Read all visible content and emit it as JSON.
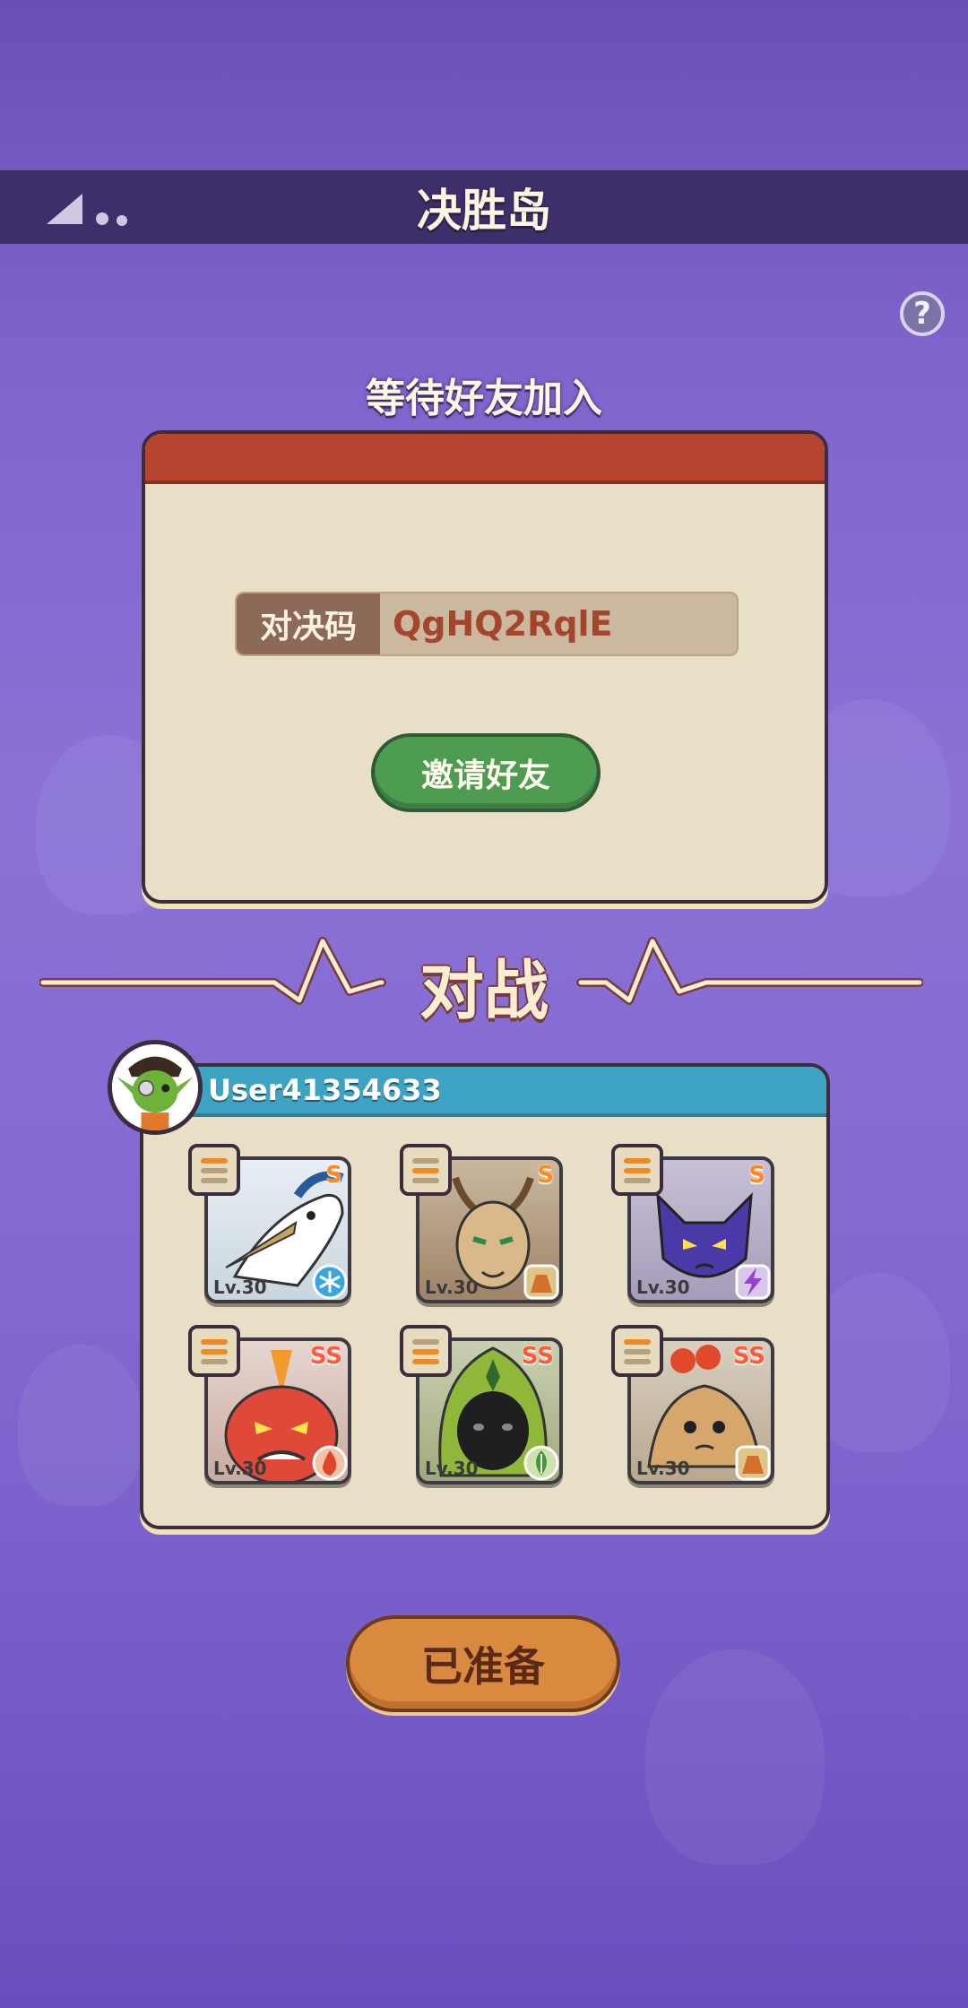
{
  "header": {
    "title": "决胜岛"
  },
  "lobby": {
    "status": "等待好友加入",
    "code_label": "对决码",
    "code_value": "QgHQ2RqlE",
    "invite_label": "邀请好友"
  },
  "battle": {
    "title": "对战"
  },
  "team": {
    "username": "User41354633",
    "monsters": [
      {
        "name": "crane",
        "rank": "S",
        "level": "Lv.30",
        "element": "ice-icon"
      },
      {
        "name": "deer",
        "rank": "S",
        "level": "Lv.30",
        "element": "earth-icon"
      },
      {
        "name": "bat",
        "rank": "S",
        "level": "Lv.30",
        "element": "lightning-icon"
      },
      {
        "name": "red-demon",
        "rank": "SS",
        "level": "Lv.30",
        "element": "fire-icon"
      },
      {
        "name": "hooded-spirit",
        "rank": "SS",
        "level": "Lv.30",
        "element": "leaf-icon"
      },
      {
        "name": "mud-blob",
        "rank": "SS",
        "level": "Lv.30",
        "element": "earth-icon"
      }
    ]
  },
  "ready_label": "已准备",
  "colors": {
    "accent_red": "#b7442f",
    "accent_blue": "#3ea2c2",
    "accent_green": "#4e9b52",
    "accent_orange": "#da8a3e"
  }
}
